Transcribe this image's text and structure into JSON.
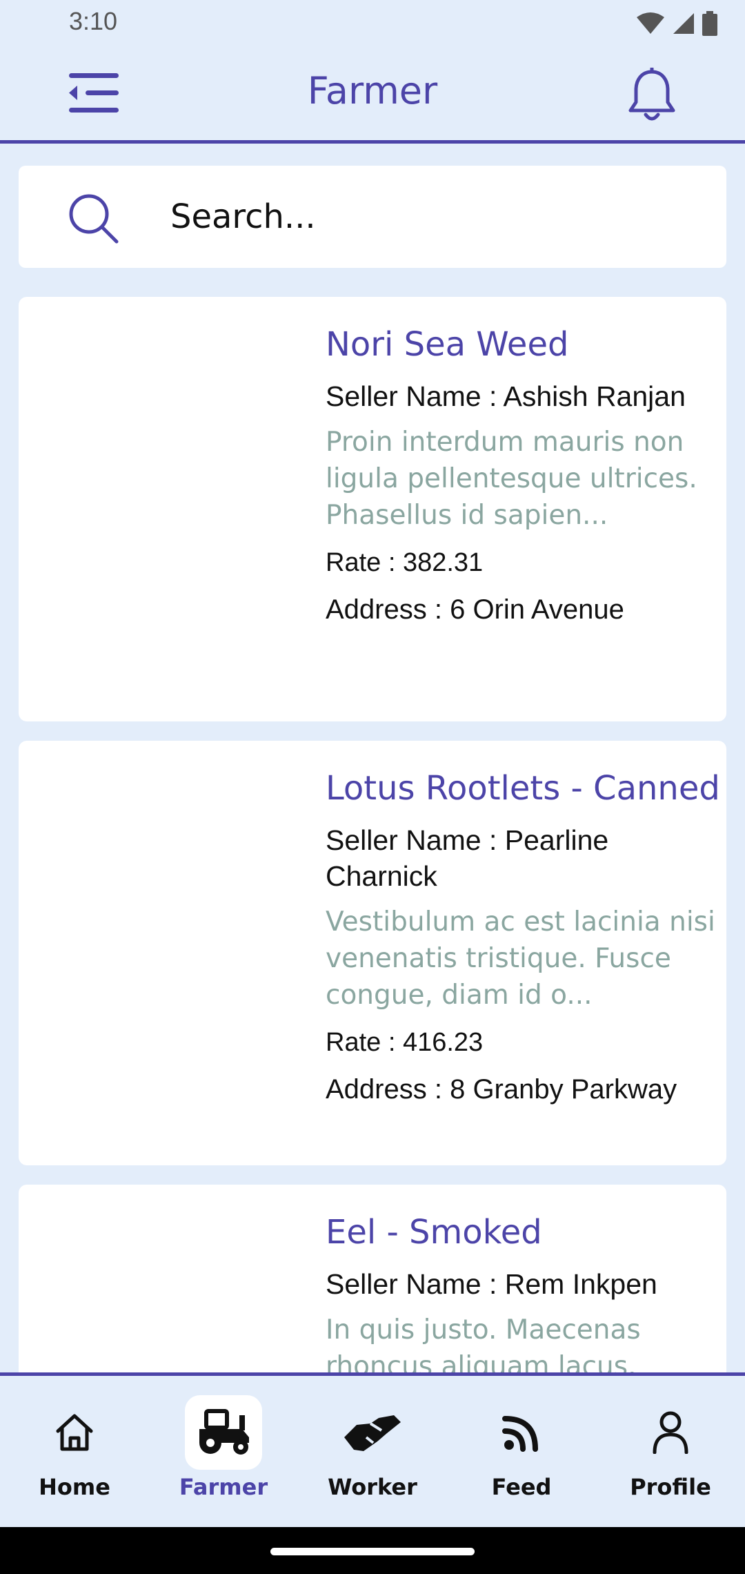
{
  "status_bar": {
    "time": "3:10"
  },
  "header": {
    "title": "Farmer"
  },
  "search": {
    "placeholder": "Search..."
  },
  "products": [
    {
      "title": "Nori Sea Weed",
      "seller": "Seller Name : Ashish Ranjan",
      "description": "Proin interdum mauris non ligula pellentesque ultrices. Phasellus id sapien...",
      "rate": "Rate : 382.31",
      "address": "Address : 6 Orin Avenue"
    },
    {
      "title": "Lotus Rootlets - Canned",
      "seller": "Seller Name : Pearline Charnick",
      "description": "Vestibulum ac est lacinia nisi venenatis tristique. Fusce congue, diam id o...",
      "rate": "Rate : 416.23",
      "address": "Address : 8 Granby Parkway"
    },
    {
      "title": "Eel - Smoked",
      "seller": "Seller Name : Rem Inkpen",
      "description": "In quis justo. Maecenas rhoncus aliquam lacus. Morbi...",
      "rate": "",
      "address": ""
    }
  ],
  "bottom_nav": {
    "items": [
      {
        "label": "Home",
        "icon": "home-icon",
        "active": false
      },
      {
        "label": "Farmer",
        "icon": "tractor-icon",
        "active": true
      },
      {
        "label": "Worker",
        "icon": "handshake-icon",
        "active": false
      },
      {
        "label": "Feed",
        "icon": "rss-icon",
        "active": false
      },
      {
        "label": "Profile",
        "icon": "user-icon",
        "active": false
      }
    ]
  },
  "colors": {
    "accent": "#4c44a8",
    "background": "#e3edfa",
    "description": "#8aa6a0"
  }
}
